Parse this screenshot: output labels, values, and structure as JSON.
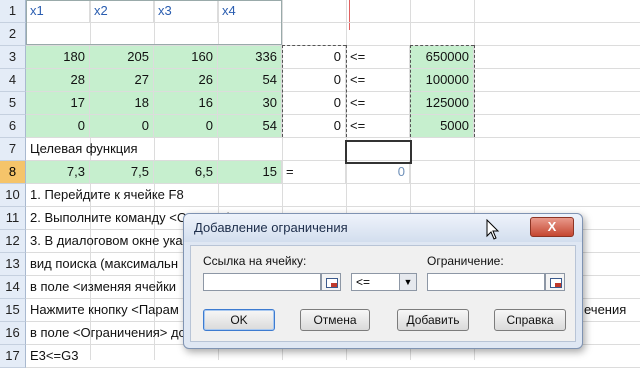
{
  "sheet": {
    "row1": {
      "num": "1",
      "c1": "x1",
      "c2": "x2",
      "c3": "x3",
      "c4": "x4"
    },
    "row2": {
      "num": "2"
    },
    "row3": {
      "num": "3",
      "a": "180",
      "b": "205",
      "c": "160",
      "d": "336",
      "e": "0",
      "f": "<=",
      "g": "650000"
    },
    "row4": {
      "num": "4",
      "a": "28",
      "b": "27",
      "c": "26",
      "d": "54",
      "e": "0",
      "f": "<=",
      "g": "100000"
    },
    "row5": {
      "num": "5",
      "a": "17",
      "b": "18",
      "c": "16",
      "d": "30",
      "e": "0",
      "f": "<=",
      "g": "125000"
    },
    "row6": {
      "num": "6",
      "a": "0",
      "b": "0",
      "c": "0",
      "d": "54",
      "e": "0",
      "f": "<=",
      "g": "5000"
    },
    "row7": {
      "num": "7",
      "text": "Целевая функция"
    },
    "row8": {
      "num": "8",
      "a": "7,3",
      "b": "7,5",
      "c": "6,5",
      "d": "15",
      "e": "=",
      "f": "0"
    },
    "row9": {
      "num": "9"
    },
    "row10": {
      "num": "10",
      "text": "1. Перейдите к ячейке F8"
    },
    "row11": {
      "num": "11",
      "text": "2. Выполните команду <Сервис / Поиск решения>"
    },
    "row12": {
      "num": "12",
      "text": "3. В диалоговом окне ука"
    },
    "row13": {
      "num": "13",
      "text": "вид поиска (максимальн"
    },
    "row14": {
      "num": "14",
      "text": "в поле <изменяя ячейки"
    },
    "row15": {
      "num": "15",
      "text": "Нажмите кнопку <Парам",
      "tail": "ечения"
    },
    "row16": {
      "num": "16",
      "text": "в поле <Ограничения> до"
    },
    "row17": {
      "num": "17",
      "text": "E3<=G3"
    },
    "row18": {
      "num": "18",
      "text": "E4<=G4"
    }
  },
  "dialog": {
    "title": "Добавление ограничения",
    "close_label": "X",
    "cell_ref_label": "Ссылка на ячейку:",
    "cell_ref_value": "",
    "operator_value": "<=",
    "constraint_label": "Ограничение:",
    "constraint_value": "",
    "ok_label": "OK",
    "cancel_label": "Отмена",
    "add_label": "Добавить",
    "help_label": "Справка"
  },
  "colors": {
    "green_fill": "#c6efce",
    "selected_row_header": "#f5c46a",
    "dialog_bg": "#dfe7f3",
    "close_red": "#c54731"
  }
}
